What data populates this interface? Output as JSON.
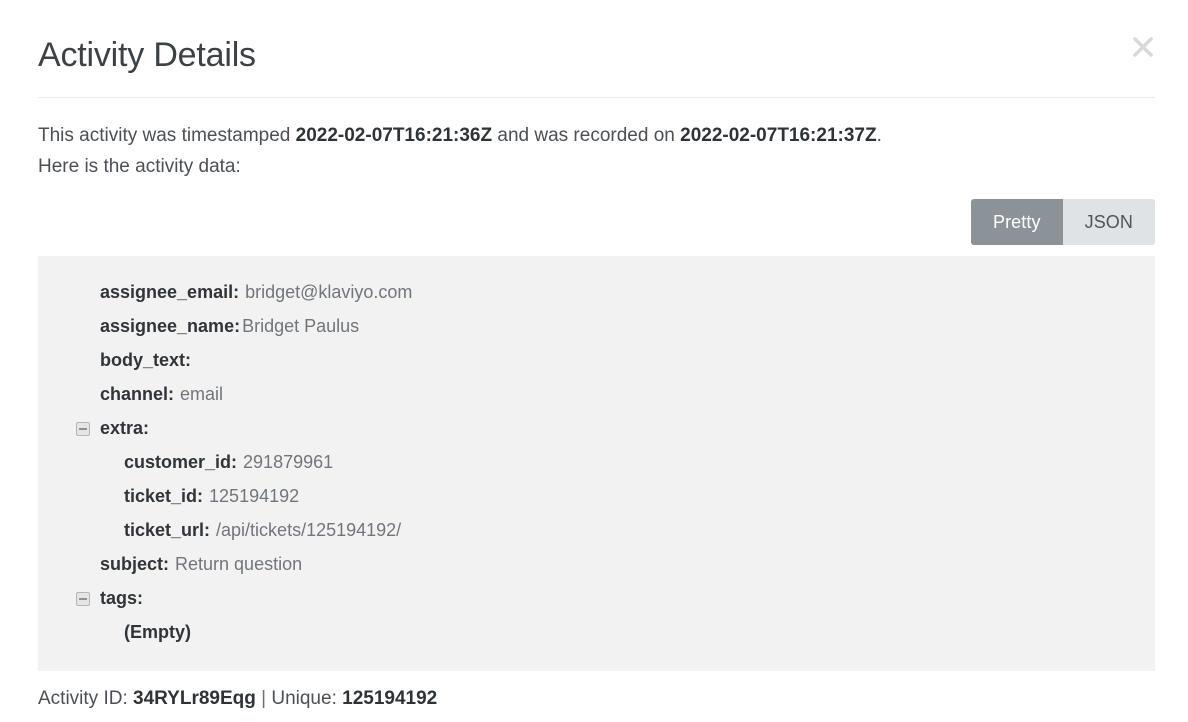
{
  "modal": {
    "title": "Activity Details",
    "close_icon": "close-icon",
    "intro": {
      "prefix": "This activity was timestamped ",
      "timestamped_value": "2022-02-07T16:21:36Z",
      "middle": " and was recorded on ",
      "recorded_value": "2022-02-07T16:21:37Z",
      "period": ".",
      "second_line": "Here is the activity data:"
    },
    "view_toggle": {
      "active": "Pretty",
      "options": [
        {
          "label": "Pretty",
          "state": "active"
        },
        {
          "label": "JSON",
          "state": "inactive"
        }
      ],
      "active_bg": "#8b9399",
      "inactive_bg": "#dfe3e6"
    },
    "data_panel": {
      "background": "#f2f2f3",
      "rows": [
        {
          "key": "assignee_email:",
          "value": "bridget@klaviyo.com"
        },
        {
          "key": "assignee_name:",
          "value": "Bridget Paulus"
        },
        {
          "key": "body_text:",
          "value": ""
        },
        {
          "key": "channel:",
          "value": "email"
        },
        {
          "key": "extra:",
          "value": "",
          "node": true,
          "toggle_icon": "collapse-minus-icon"
        },
        {
          "key": "customer_id:",
          "value": "291879961",
          "child": true
        },
        {
          "key": "ticket_id:",
          "value": "125194192",
          "child": true
        },
        {
          "key": "ticket_url:",
          "value": "/api/tickets/125194192/",
          "child": true
        },
        {
          "key": "subject:",
          "value": "Return question"
        },
        {
          "key": "tags:",
          "value": "",
          "node": true,
          "toggle_icon": "collapse-minus-icon"
        },
        {
          "key": "(Empty)",
          "value": "",
          "child": true,
          "empty": true
        }
      ]
    },
    "footer": {
      "activity_id_label": "Activity ID:",
      "activity_id_value": "34RYLr89Eqg",
      "separator": "|",
      "unique_label": "Unique:",
      "unique_value": "125194192"
    }
  }
}
